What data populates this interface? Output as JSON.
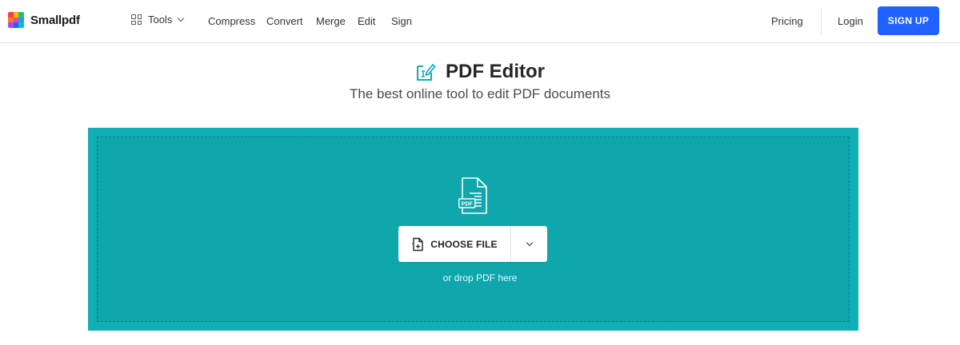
{
  "brand": {
    "name": "Smallpdf",
    "logo_colors": [
      "#ff3f3f",
      "#ffb900",
      "#20c06b",
      "#ff7a1a",
      "#ff3fa0",
      "#1f9bff",
      "#a04dff",
      "#1f62ff",
      "#00c2c7"
    ]
  },
  "header": {
    "tools_label": "Tools",
    "nav": [
      "Compress",
      "Convert",
      "Merge",
      "Edit",
      "Sign"
    ],
    "pricing_label": "Pricing",
    "login_label": "Login",
    "signup_label": "SIGN UP"
  },
  "main": {
    "title": "PDF Editor",
    "subtitle": "The best online tool to edit PDF documents",
    "title_icon": "pdf-edit-icon"
  },
  "upload": {
    "file_badge": "PDF",
    "choose_label": "CHOOSE FILE",
    "drop_hint": "or drop PDF here"
  },
  "colors": {
    "accent": "#1f62ff",
    "dropzone": "#10aeb5",
    "title_icon": "#10aeb5"
  }
}
